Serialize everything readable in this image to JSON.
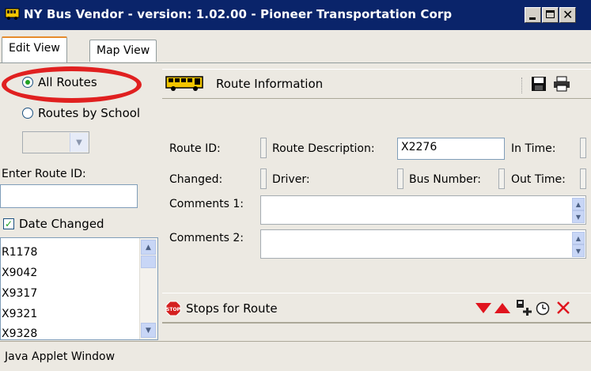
{
  "window": {
    "title": "NY Bus Vendor - version: 1.02.00 - Pioneer Transportation Corp",
    "controls": [
      "minimize-icon",
      "maximize-icon",
      "close-icon"
    ]
  },
  "tabs": [
    {
      "label": "Edit View",
      "active": true
    },
    {
      "label": "Map View",
      "active": false
    }
  ],
  "left_panel": {
    "radio_all_routes": {
      "label": "All Routes",
      "selected": true
    },
    "radio_routes_by_school": {
      "label": "Routes by School",
      "selected": false
    },
    "school_select": {
      "value": ""
    },
    "route_id_label": "Enter Route ID:",
    "route_id_value": "",
    "date_changed": {
      "label": "Date Changed",
      "checked": true
    },
    "route_list": [
      "R1178",
      "X9042",
      "X9317",
      "X9321",
      "X9328"
    ]
  },
  "route_info": {
    "title": "Route Information",
    "icons": [
      "bus-icon",
      "save-icon",
      "print-icon"
    ],
    "fields": {
      "route_id": {
        "label": "Route ID:",
        "value": ""
      },
      "route_description": {
        "label": "Route Description:",
        "value": "X2276"
      },
      "in_time": {
        "label": "In Time:",
        "value": ""
      },
      "changed": {
        "label": "Changed:",
        "value": ""
      },
      "driver": {
        "label": "Driver:",
        "value": ""
      },
      "bus_number": {
        "label": "Bus Number:",
        "value": ""
      },
      "out_time": {
        "label": "Out Time:",
        "value": ""
      },
      "comments1": {
        "label": "Comments 1:",
        "value": ""
      },
      "comments2": {
        "label": "Comments 2:",
        "value": ""
      }
    }
  },
  "stops": {
    "title": "Stops for Route",
    "icons": [
      "stop-sign-icon",
      "move-down-icon",
      "move-up-icon",
      "add-stop-icon",
      "clock-icon",
      "delete-icon"
    ]
  },
  "status_bar": {
    "text": "Java Applet Window"
  },
  "colors": {
    "titlebar": "#0a246a",
    "accent_red": "#e02020",
    "tab_highlight": "#e68b2c"
  }
}
